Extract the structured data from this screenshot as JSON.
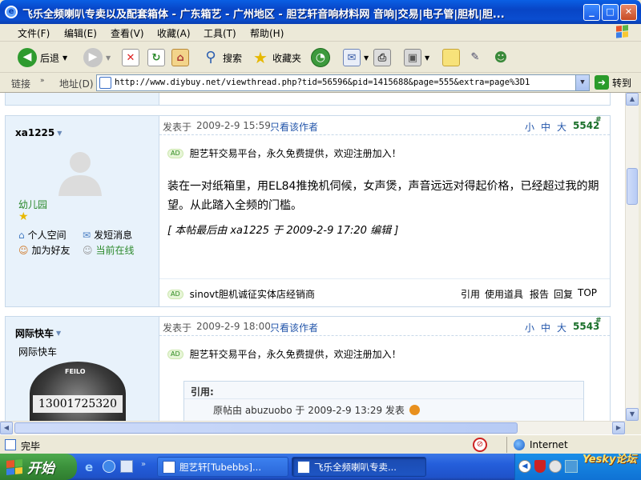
{
  "window": {
    "title": "飞乐全频喇叭专卖以及配套箱体 - 广东箱艺 - 广州地区 - 胆艺轩音响材料网 音响|交易|电子管|胆机|胆...",
    "min": "_",
    "max": "□",
    "close": "✕"
  },
  "menu": [
    "文件(F)",
    "编辑(E)",
    "查看(V)",
    "收藏(A)",
    "工具(T)",
    "帮助(H)"
  ],
  "toolbar": {
    "back": "后退",
    "search": "搜索",
    "favorites": "收藏夹"
  },
  "address": {
    "links_label": "链接",
    "address_label": "地址(D)",
    "url": "http://www.diybuy.net/viewthread.php?tid=56596&pid=1415688&page=555&extra=page%3D1",
    "go": "转到"
  },
  "posts": [
    {
      "user": "xa1225",
      "group": "幼儿园",
      "links": [
        "个人空间",
        "发短消息",
        "加为好友",
        "当前在线"
      ],
      "posted_prefix": "发表于",
      "date": "2009-2-9 15:59",
      "view_author": "只看该作者",
      "size_ctrl": [
        "小",
        "中",
        "大"
      ],
      "post_no": "5542",
      "ad_label": "AD",
      "ad_text": "胆艺轩交易平台，永久免费提供，欢迎注册加入！",
      "body": "装在一对纸箱里，用EL84推挽机伺候，女声煲，声音远远对得起价格，已经超过我的期望。从此踏入全频的门槛。",
      "edit_note": "[ 本帖最后由 xa1225 于 2009-2-9 17:20 编辑 ]",
      "footer_ad": "sinovt胆机诚征实体店经销商",
      "actions": [
        "引用",
        "使用道具",
        "报告",
        "回复",
        "TOP"
      ]
    },
    {
      "user": "网际快车",
      "title": "网际快车",
      "phone": "13001725320",
      "speaker_brand": "FEILO",
      "posted_prefix": "发表于",
      "date": "2009-2-9 18:00",
      "view_author": "只看该作者",
      "size_ctrl": [
        "小",
        "中",
        "大"
      ],
      "post_no": "5543",
      "ad_label": "AD",
      "ad_text": "胆艺轩交易平台，永久免费提供，欢迎注册加入！",
      "quote_label": "引用:",
      "quote_line": "原帖由 abuzuobo 于 2009-2-9 13:29 发表"
    }
  ],
  "status": {
    "text": "完毕",
    "zone": "Internet"
  },
  "taskbar": {
    "start": "开始",
    "tasks": [
      "胆艺轩[Tubebbs]...",
      "飞乐全频喇叭专卖..."
    ],
    "watermark": "Yesky论坛"
  }
}
